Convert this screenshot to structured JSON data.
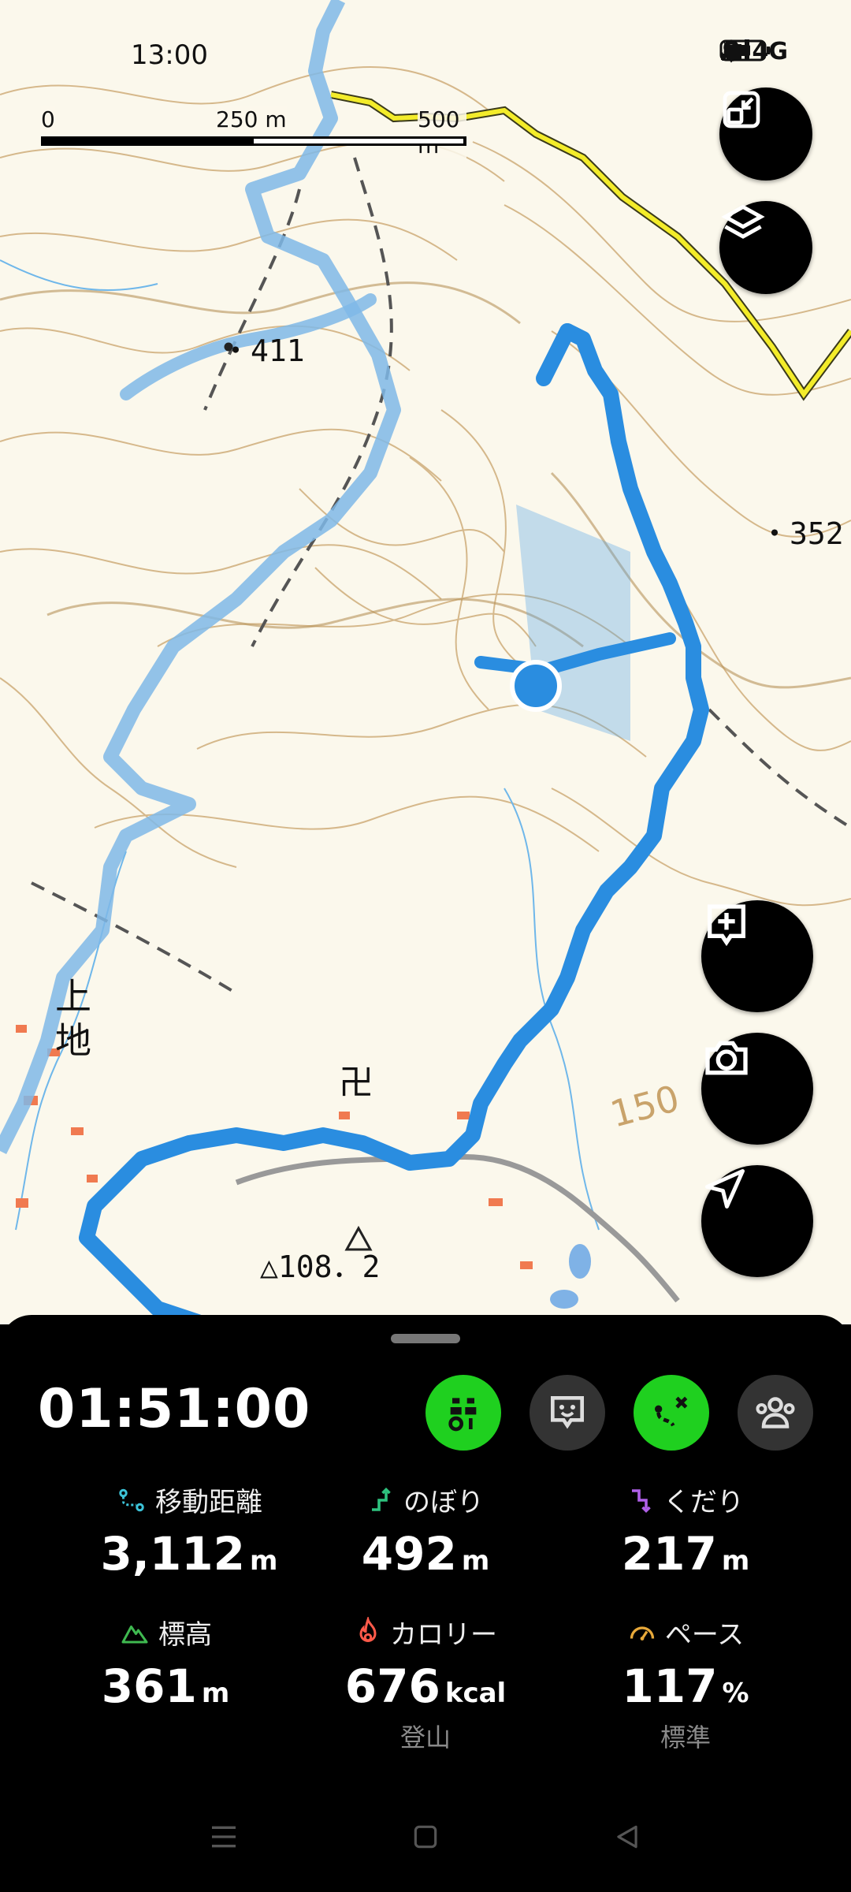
{
  "status_bar": {
    "time": "13:00",
    "network": "4G",
    "volte": "Vo LTE"
  },
  "map": {
    "scale": {
      "start": "0",
      "mid": "250 m",
      "end": "500 m"
    },
    "spot_heights": [
      "・411",
      "・352",
      "△108．2"
    ],
    "place_name": "上地",
    "contour_label": "150",
    "buttons": [
      "expand-button",
      "layers-button",
      "add-note-button",
      "camera-button",
      "navigate-button"
    ]
  },
  "activity": {
    "elapsed": "01:51:00",
    "actions": [
      "gear-check",
      "chat-face",
      "route",
      "group"
    ],
    "stats": [
      {
        "label": "移動距離",
        "value": "3,112",
        "unit": "m",
        "sub": ""
      },
      {
        "label": "のぼり",
        "value": "492",
        "unit": "m",
        "sub": ""
      },
      {
        "label": "くだり",
        "value": "217",
        "unit": "m",
        "sub": ""
      },
      {
        "label": "標高",
        "value": "361",
        "unit": "m",
        "sub": ""
      },
      {
        "label": "カロリー",
        "value": "676",
        "unit": "kcal",
        "sub": "登山"
      },
      {
        "label": "ペース",
        "value": "117",
        "unit": "%",
        "sub": "標準"
      }
    ],
    "colors": {
      "accent_green": "#1fd01f",
      "track_blue": "#2a8de0",
      "past_track": "#7fb8e8"
    }
  }
}
